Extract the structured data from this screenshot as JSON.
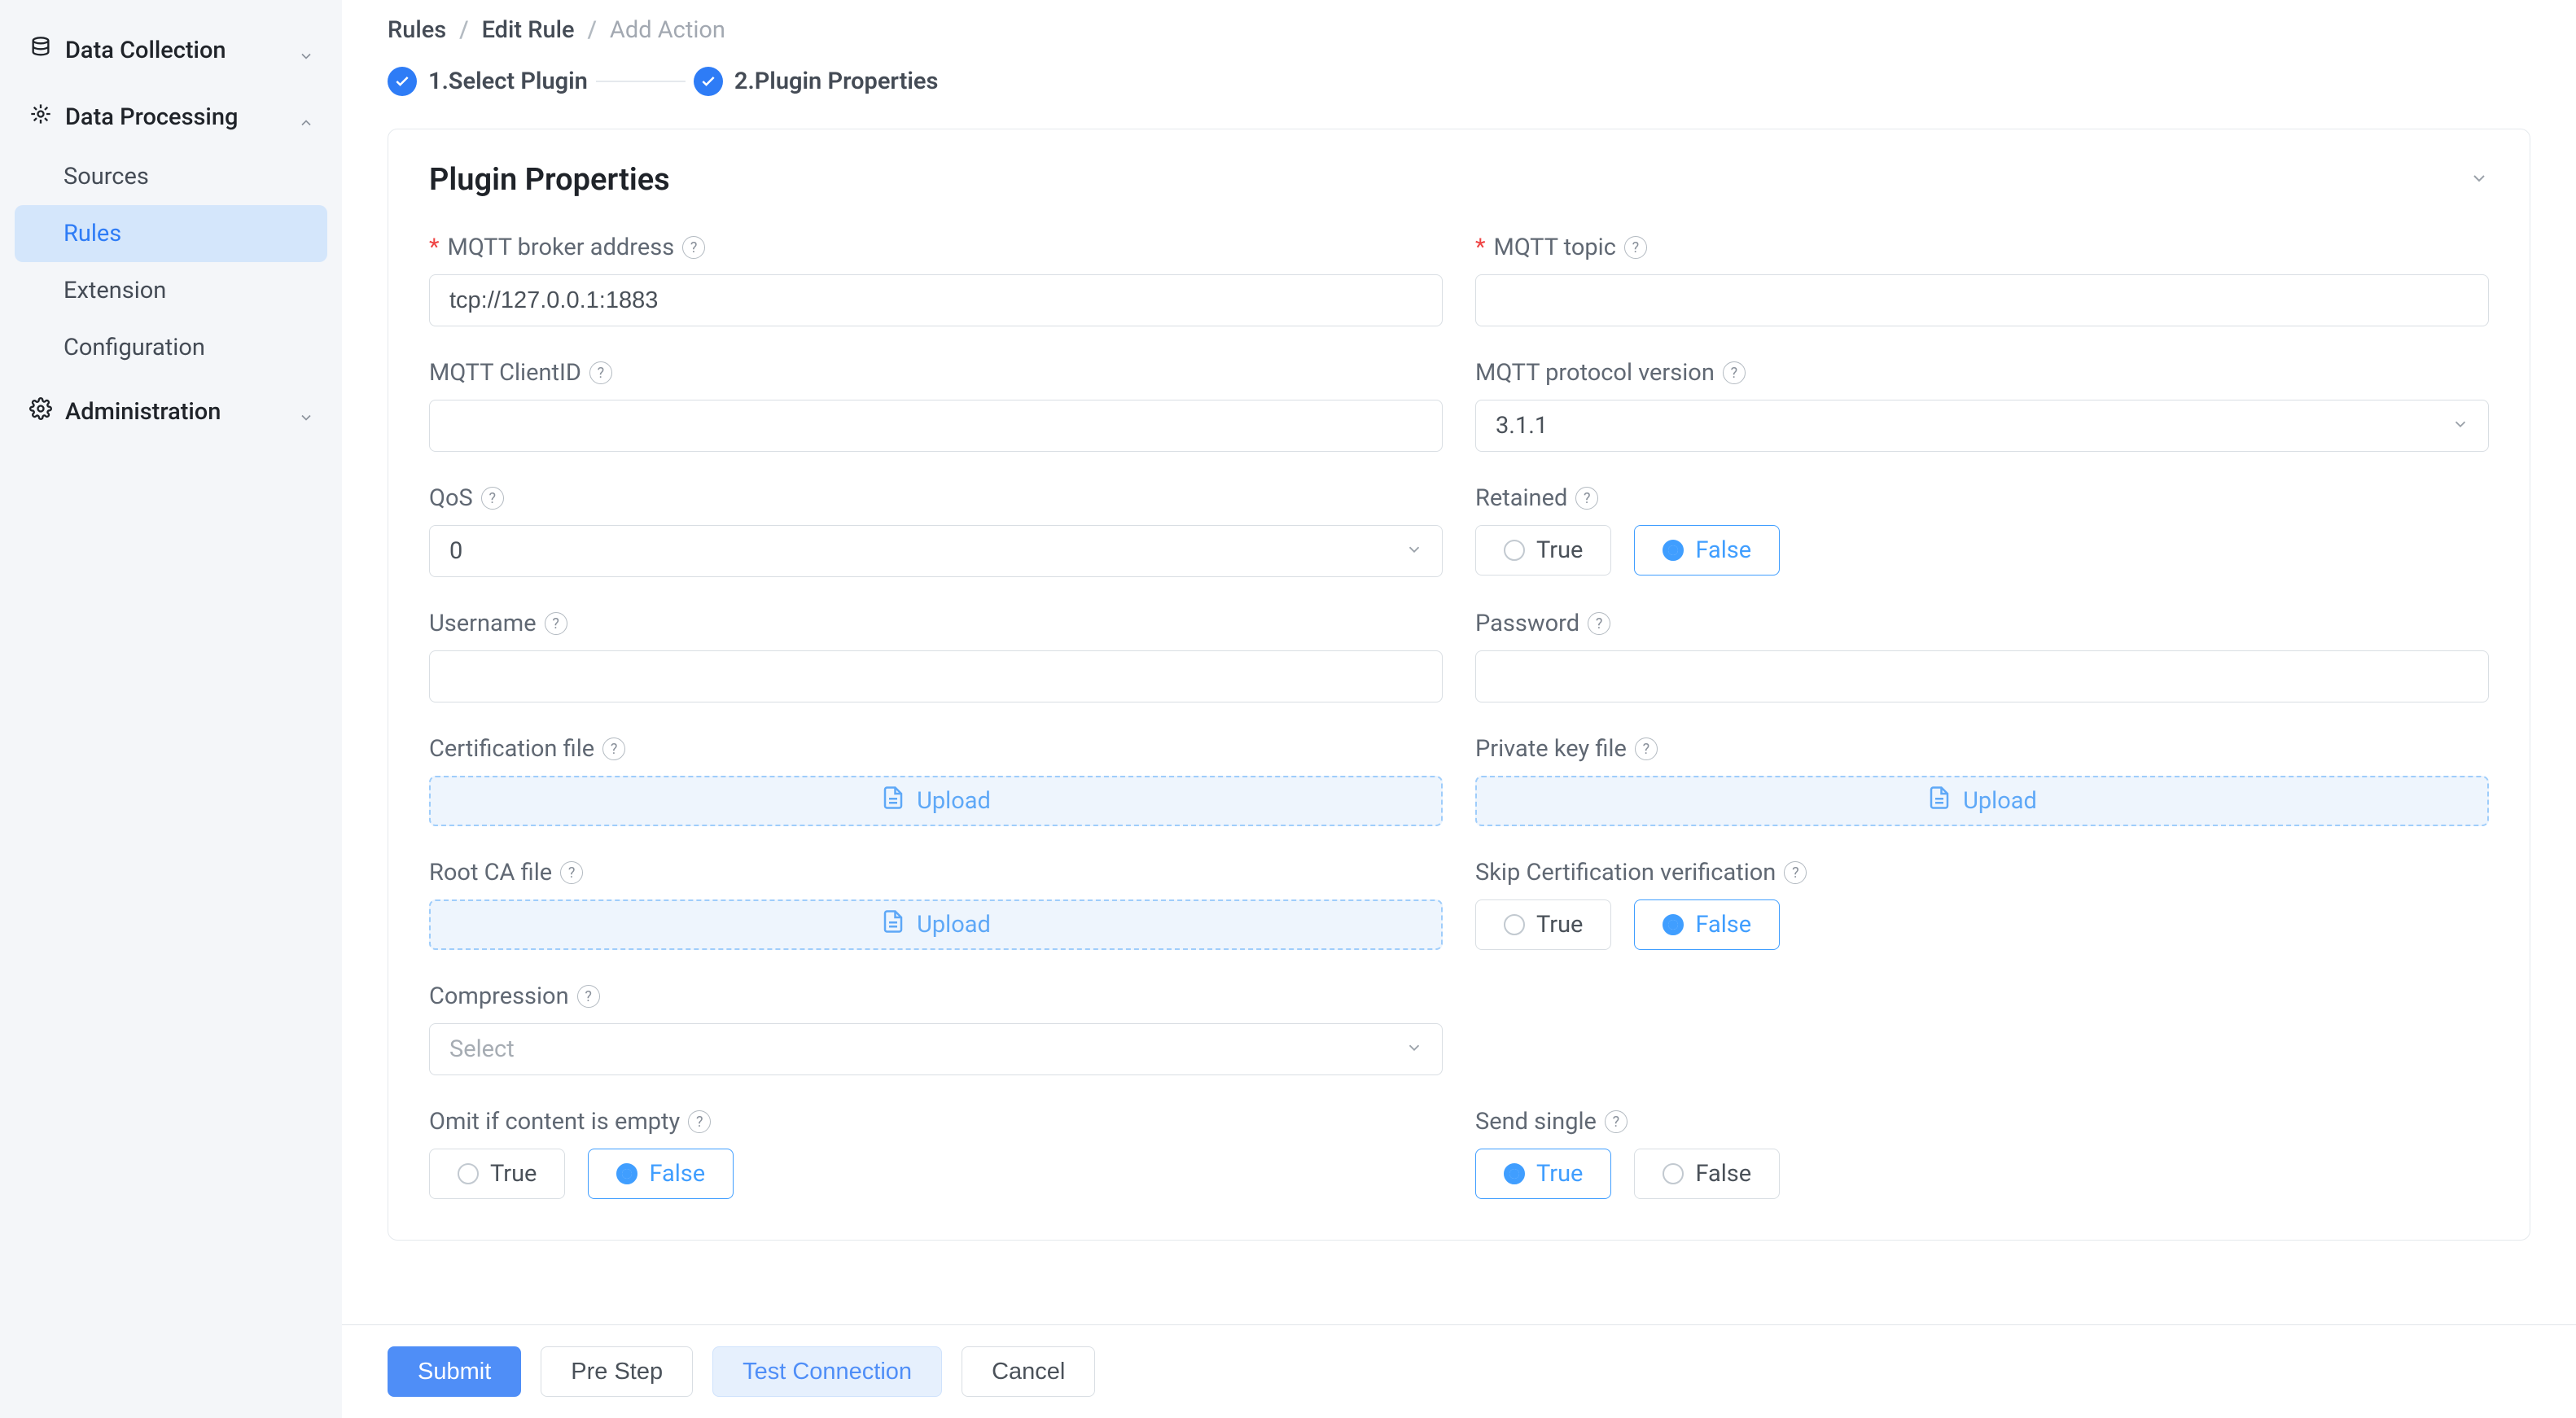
{
  "sidebar": {
    "sections": [
      {
        "label": "Data Collection",
        "expanded": false
      },
      {
        "label": "Data Processing",
        "expanded": true,
        "items": [
          "Sources",
          "Rules",
          "Extension",
          "Configuration"
        ],
        "activeIndex": 1
      },
      {
        "label": "Administration",
        "expanded": false
      }
    ]
  },
  "breadcrumbs": [
    "Rules",
    "Edit Rule",
    "Add Action"
  ],
  "steps": [
    {
      "label": "1.Select Plugin"
    },
    {
      "label": "2.Plugin Properties"
    }
  ],
  "card": {
    "title": "Plugin Properties"
  },
  "form": {
    "broker_address": {
      "label": "MQTT broker address",
      "value": "tcp://127.0.0.1:1883",
      "required": true
    },
    "topic": {
      "label": "MQTT topic",
      "value": "",
      "required": true
    },
    "client_id": {
      "label": "MQTT ClientID",
      "value": ""
    },
    "protocol": {
      "label": "MQTT protocol version",
      "value": "3.1.1"
    },
    "qos": {
      "label": "QoS",
      "value": "0"
    },
    "retained": {
      "label": "Retained",
      "value": "False",
      "options": [
        "True",
        "False"
      ]
    },
    "username": {
      "label": "Username",
      "value": ""
    },
    "password": {
      "label": "Password",
      "value": ""
    },
    "cert_file": {
      "label": "Certification file",
      "action": "Upload"
    },
    "key_file": {
      "label": "Private key file",
      "action": "Upload"
    },
    "root_ca": {
      "label": "Root CA file",
      "action": "Upload"
    },
    "skip_verify": {
      "label": "Skip Certification verification",
      "value": "False",
      "options": [
        "True",
        "False"
      ]
    },
    "compression": {
      "label": "Compression",
      "placeholder": "Select"
    },
    "omit_empty": {
      "label": "Omit if content is empty",
      "value": "False",
      "options": [
        "True",
        "False"
      ]
    },
    "send_single": {
      "label": "Send single",
      "value": "True",
      "options": [
        "True",
        "False"
      ]
    }
  },
  "footer": {
    "submit": "Submit",
    "pre_step": "Pre Step",
    "test_conn": "Test Connection",
    "cancel": "Cancel"
  }
}
